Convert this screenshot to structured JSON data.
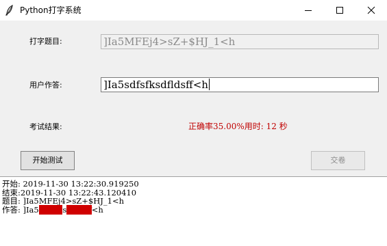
{
  "window": {
    "title": "Python打字系统"
  },
  "form": {
    "topic_label": "打字题目:",
    "topic_value": "]Ia5MFEj4>sZ+$HJ_1<h",
    "answer_label": "用户作答:",
    "answer_value": "]Ia5sdfsfksdfldsff<h",
    "result_label": "考试结果:",
    "result_text": "正确率35.00%用时: 12 秒"
  },
  "buttons": {
    "start_label": "开始测试",
    "submit_label": "交卷"
  },
  "log": {
    "start_line": "开始: 2019-11-30 13:22:30.919250",
    "end_line": "结束:2019-11-30 13:22:43.120410",
    "topic_line": "题目: ]Ia5MFEj4>sZ+$HJ_1<h",
    "answer_prefix": "作答: ]Ia5",
    "answer_err1": "sdfsfk",
    "answer_ok1": "s",
    "answer_err2": "dfldsff",
    "answer_ok2": "<h"
  },
  "colors": {
    "result": "#c00000",
    "error_highlight": "#d00000"
  }
}
